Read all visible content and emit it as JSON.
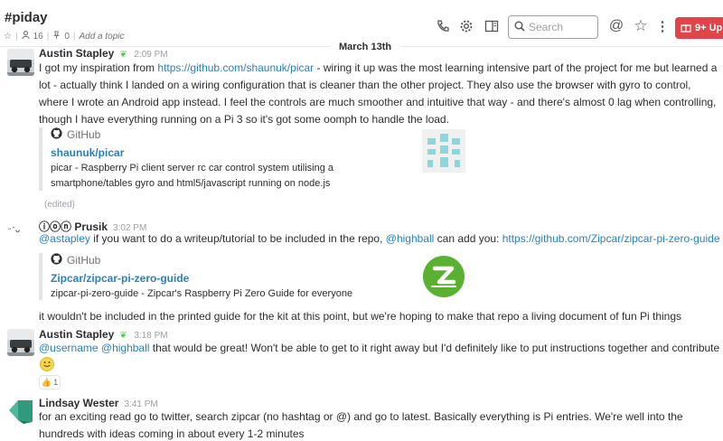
{
  "header": {
    "channel_name": "#piday",
    "member_count": "16",
    "pinned_count": "0",
    "add_topic": "Add a topic",
    "search_placeholder": "Search",
    "notifications_label": "9+ Up"
  },
  "date_divider": "March 13th",
  "messages": [
    {
      "author": "Austin Stapley",
      "time": "2:09 PM",
      "text_before_link": "I got my inspiration from ",
      "link": "https://github.com/shaunuk/picar",
      "text_after_link": " - wiring it up was the most learning intensive part of the project for me but learned a lot - actually think I landed on a wiring configuration that is cleaner than the other project. They also use the browser with gyro to control, where I wrote an Android app instead. I feel the controls are much smoother and intuitive that way - and there's almost 0 lag when controlling, though I have everything running on a Pi 3 so it's got some oomph to handle the load.",
      "attachment": {
        "service": "GitHub",
        "title": "shaunuk/picar",
        "description": "picar - Raspberry Pi client server rc car control system utilising a smartphone/tables gyro and html5/javascript running on node.js"
      },
      "edited": "(edited)"
    },
    {
      "author": "ⓘⓞⓝ Prusik",
      "time": "3:02 PM",
      "mention1": "@astapley",
      "text1": " if you want to do a writeup/tutorial to be included in the repo, ",
      "mention2": "@highball",
      "text2": " can add you: ",
      "link": "https://github.com/Zipcar/zipcar-pi-zero-guide",
      "attachment": {
        "service": "GitHub",
        "title": "Zipcar/zipcar-pi-zero-guide",
        "description": "zipcar-pi-zero-guide - Zipcar's Raspberry Pi Zero Guide for everyone"
      },
      "followup": "it wouldn't be included in the printed guide for the kit at this point, but we're hoping to make that repo a living document of fun Pi things"
    },
    {
      "author": "Austin Stapley",
      "time": "3:18 PM",
      "mention1": "@username",
      "mention2": "@highball",
      "text": " that would be great! Won't be able to get to it right away but I'd definitely like to put instructions together and contribute",
      "reaction_count": "1"
    },
    {
      "author": "Lindsay Wester",
      "time": "3:41 PM",
      "text": "for an exciting read go to twitter, search zipcar (no hashtag or @) and go to latest. Basically everything is Pi entries. We're well into the hundreds with ideas coming in about every 1-2 minutes"
    }
  ],
  "colors": {
    "link": "#2a80b9",
    "notification": "#e0454b",
    "zipcar_green": "#5ab031",
    "lindsay_avatar": "#2f9b7c"
  }
}
